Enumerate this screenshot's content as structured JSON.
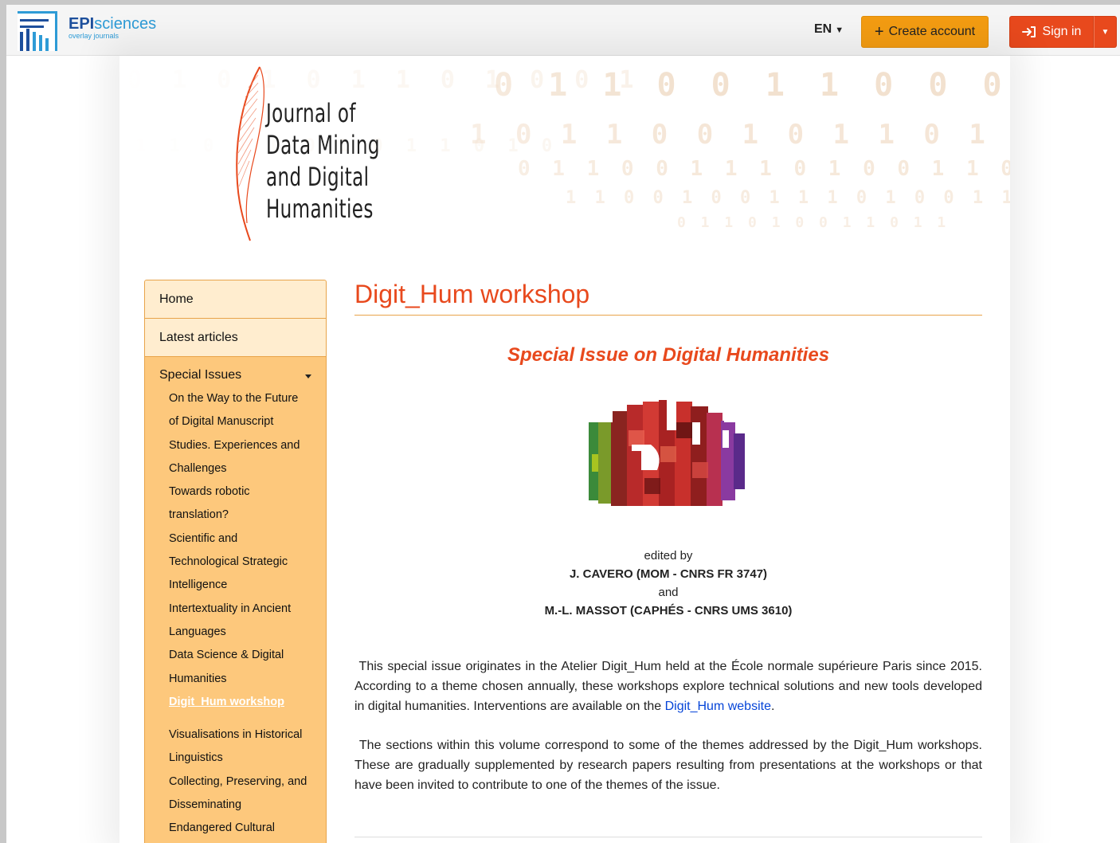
{
  "topbar": {
    "brand_bold": "EPI",
    "brand_light": "sciences",
    "brand_sub": "overlay journals",
    "lang": "EN",
    "lang_caret": "▼",
    "create_icon": "+",
    "create_label": "Create account",
    "signin_icon": "➜]",
    "signin_label": "Sign in",
    "signin_caret": "▼"
  },
  "journal": {
    "title_lines": [
      "Journal of",
      "Data Mining",
      "and Digital",
      "Humanities"
    ],
    "accent_color": "#e8491d"
  },
  "sidebar": {
    "home": "Home",
    "latest": "Latest articles",
    "special": "Special Issues",
    "items_before": [
      "On the Way to the Future",
      "of Digital Manuscript",
      "Studies. Experiences and",
      "Challenges",
      "Towards robotic",
      "translation?",
      "Scientific and",
      "Technological Strategic",
      "Intelligence",
      "Intertextuality in Ancient",
      "Languages",
      "Data Science & Digital",
      "Humanities"
    ],
    "active_item": "Digit_Hum workshop",
    "items_after": [
      "Visualisations in Historical",
      "Linguistics",
      "Collecting, Preserving, and",
      "Disseminating",
      "Endangered Cultural"
    ]
  },
  "main": {
    "title": "Digit_Hum workshop",
    "subtitle": "Special Issue on Digital Humanities",
    "edited_by": "edited by",
    "editor1": "J. CAVERO (MOM - CNRS FR 3747)",
    "and": "and",
    "editor2": "M.-L. MASSOT (CAPHÉS - CNRS UMS 3610)",
    "para1_text": "This special issue originates in the Atelier Digit_Hum held at the École normale supérieure Paris since 2015. According to a theme chosen annually, these workshops explore technical solutions and new tools developed in digital humanities. Interventions are available on the ",
    "para1_link": "Digit_Hum website",
    "para1_end": ".",
    "para2": "The sections within this volume correspond to some of the themes addressed by the Digit_Hum workshops. These are gradually supplemented by research papers resulting from presentations at the workshops or that have been invited to contribute to one of the themes of the issue."
  },
  "colors": {
    "create_button": "#f39c12",
    "signin_button": "#e8491d",
    "sidebar_bg": "#fdc87c",
    "link": "#0645d8"
  }
}
